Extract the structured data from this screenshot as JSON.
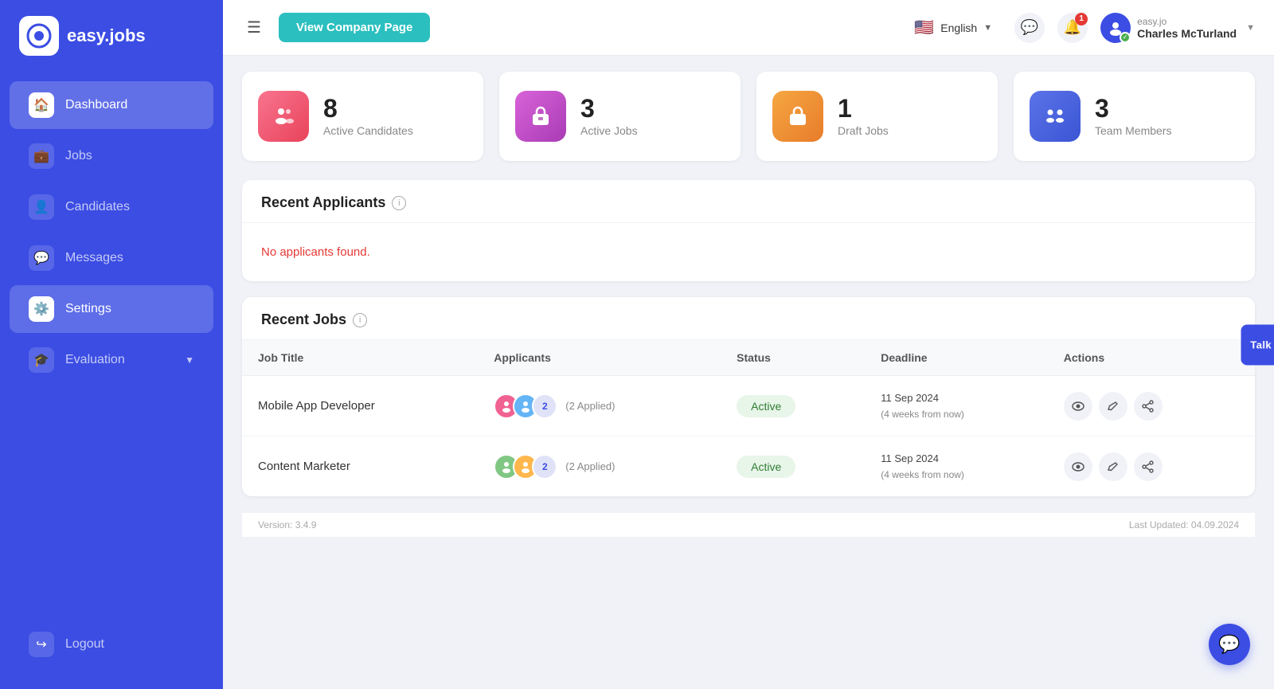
{
  "app": {
    "name": "easy.jobs",
    "logo_char": "Q"
  },
  "sidebar": {
    "items": [
      {
        "id": "dashboard",
        "label": "Dashboard",
        "icon": "🏠",
        "active": true
      },
      {
        "id": "jobs",
        "label": "Jobs",
        "icon": "💼",
        "active": false
      },
      {
        "id": "candidates",
        "label": "Candidates",
        "icon": "👤",
        "active": false
      },
      {
        "id": "messages",
        "label": "Messages",
        "icon": "💬",
        "active": false
      },
      {
        "id": "settings",
        "label": "Settings",
        "icon": "⚙️",
        "active": true,
        "current": true
      },
      {
        "id": "evaluation",
        "label": "Evaluation",
        "icon": "🎓",
        "active": false,
        "has_chevron": true
      }
    ],
    "logout_label": "Logout"
  },
  "header": {
    "view_company_btn": "View Company Page",
    "language": "English",
    "notification_count": "1",
    "profile": {
      "company": "easy.jo",
      "name": "Charles McTurland"
    }
  },
  "stats": [
    {
      "id": "active-candidates",
      "value": "8",
      "label": "Active Candidates",
      "icon": "👤",
      "color": "pink"
    },
    {
      "id": "active-jobs",
      "value": "3",
      "label": "Active Jobs",
      "icon": "💼",
      "color": "purple"
    },
    {
      "id": "draft-jobs",
      "value": "1",
      "label": "Draft Jobs",
      "icon": "🗂️",
      "color": "orange"
    },
    {
      "id": "team-members",
      "value": "3",
      "label": "Team Members",
      "icon": "👥",
      "color": "blue"
    }
  ],
  "recent_applicants": {
    "title": "Recent Applicants",
    "empty_message": "No applicants found."
  },
  "recent_jobs": {
    "title": "Recent Jobs",
    "columns": [
      "Job Title",
      "Applicants",
      "Status",
      "Deadline",
      "Actions"
    ],
    "rows": [
      {
        "id": "mobile-app-dev",
        "title": "Mobile App Developer",
        "applicants_count": "2",
        "applied_text": "(2 Applied)",
        "status": "Active",
        "deadline": "11 Sep 2024",
        "deadline_note": "(4 weeks from now)"
      },
      {
        "id": "content-marketer",
        "title": "Content Marketer",
        "applicants_count": "2",
        "applied_text": "(2 Applied)",
        "status": "Active",
        "deadline": "11 Sep 2024",
        "deadline_note": "(4 weeks from now)"
      }
    ]
  },
  "support": {
    "label": "Talk to Support"
  },
  "footer": {
    "version": "Version: 3.4.9",
    "last_updated": "Last Updated: 04.09.2024"
  }
}
